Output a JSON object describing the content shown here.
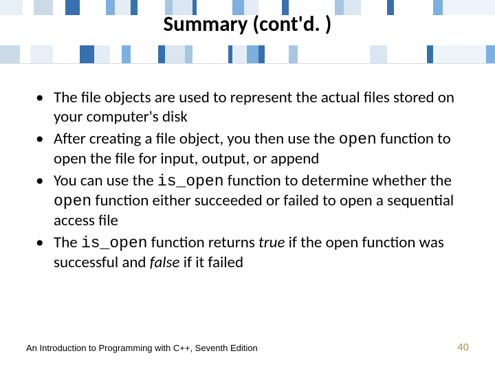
{
  "title": "Summary (cont'd. )",
  "bullets": [
    {
      "segments": [
        {
          "t": "The file objects are used to represent the actual files stored on your computer's disk"
        }
      ]
    },
    {
      "segments": [
        {
          "t": "After creating a file object, you then use the "
        },
        {
          "t": "open",
          "code": true
        },
        {
          "t": " function to open the file for input, output, or append"
        }
      ]
    },
    {
      "segments": [
        {
          "t": "You can use the "
        },
        {
          "t": "is_open",
          "code": true
        },
        {
          "t": " function to determine whether the "
        },
        {
          "t": "open",
          "code": true
        },
        {
          "t": " function either succeeded or failed to open a sequential access file"
        }
      ]
    },
    {
      "segments": [
        {
          "t": "The "
        },
        {
          "t": "is_open",
          "code": true
        },
        {
          "t": " function returns "
        },
        {
          "t": "true",
          "em": true
        },
        {
          "t": " if the open function was successful and "
        },
        {
          "t": "false",
          "em": true
        },
        {
          "t": " if it failed"
        }
      ]
    }
  ],
  "footer": "An Introduction to Programming with C++, Seventh Edition",
  "page": "40"
}
